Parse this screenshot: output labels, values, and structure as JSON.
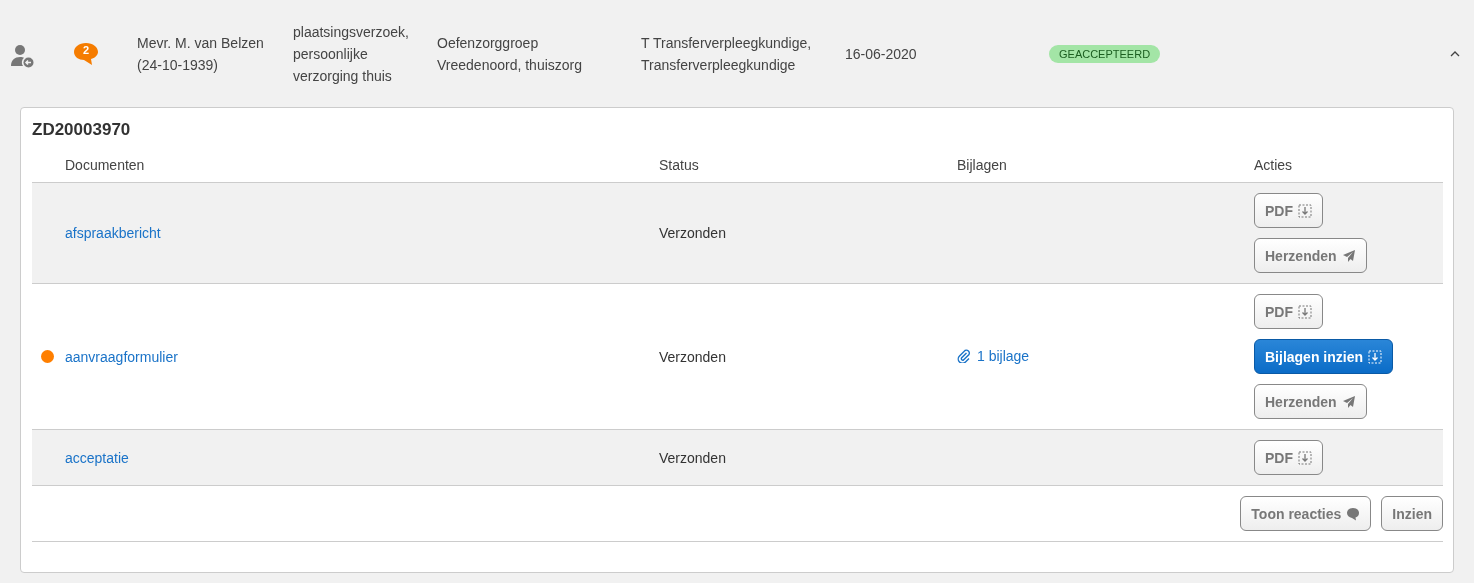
{
  "header": {
    "messages": "2",
    "client": [
      "Mevr. M. van Belzen",
      "(24-10-1939)"
    ],
    "request": [
      "plaatsingsverzoek,",
      "persoonlijke",
      "verzorging thuis"
    ],
    "organisation": [
      "Oefenzorggroep",
      "Vreedenoord, thuiszorg"
    ],
    "contact": [
      "T Transferverpleegkundige,",
      "Transferverpleegkundige"
    ],
    "date": "16-06-2020",
    "status": "GEACCEPTEERD",
    "expanded": true
  },
  "dossier": {
    "title": "ZD20003970",
    "columns": [
      "Documenten",
      "Status",
      "Bijlagen",
      "Acties"
    ],
    "rows": [
      {
        "document": "afspraakbericht",
        "status": "Verzonden",
        "marked": false,
        "actions": [
          {
            "kind": "pdf",
            "label": "PDF"
          },
          {
            "kind": "resend",
            "label": "Herzenden"
          }
        ]
      },
      {
        "document": "aanvraagformulier",
        "status": "Verzonden",
        "marked": true,
        "attachment": "1 bijlage",
        "actions": [
          {
            "kind": "pdf",
            "label": "PDF"
          },
          {
            "kind": "attachments",
            "label": "Bijlagen inzien"
          },
          {
            "kind": "resend",
            "label": "Herzenden"
          }
        ]
      },
      {
        "document": "acceptatie",
        "status": "Verzonden",
        "marked": false,
        "actions": [
          {
            "kind": "pdf",
            "label": "PDF"
          }
        ]
      }
    ],
    "footer_actions": [
      {
        "kind": "comments",
        "label": "Toon reacties"
      },
      {
        "kind": "view",
        "label": "Inzien"
      }
    ]
  }
}
